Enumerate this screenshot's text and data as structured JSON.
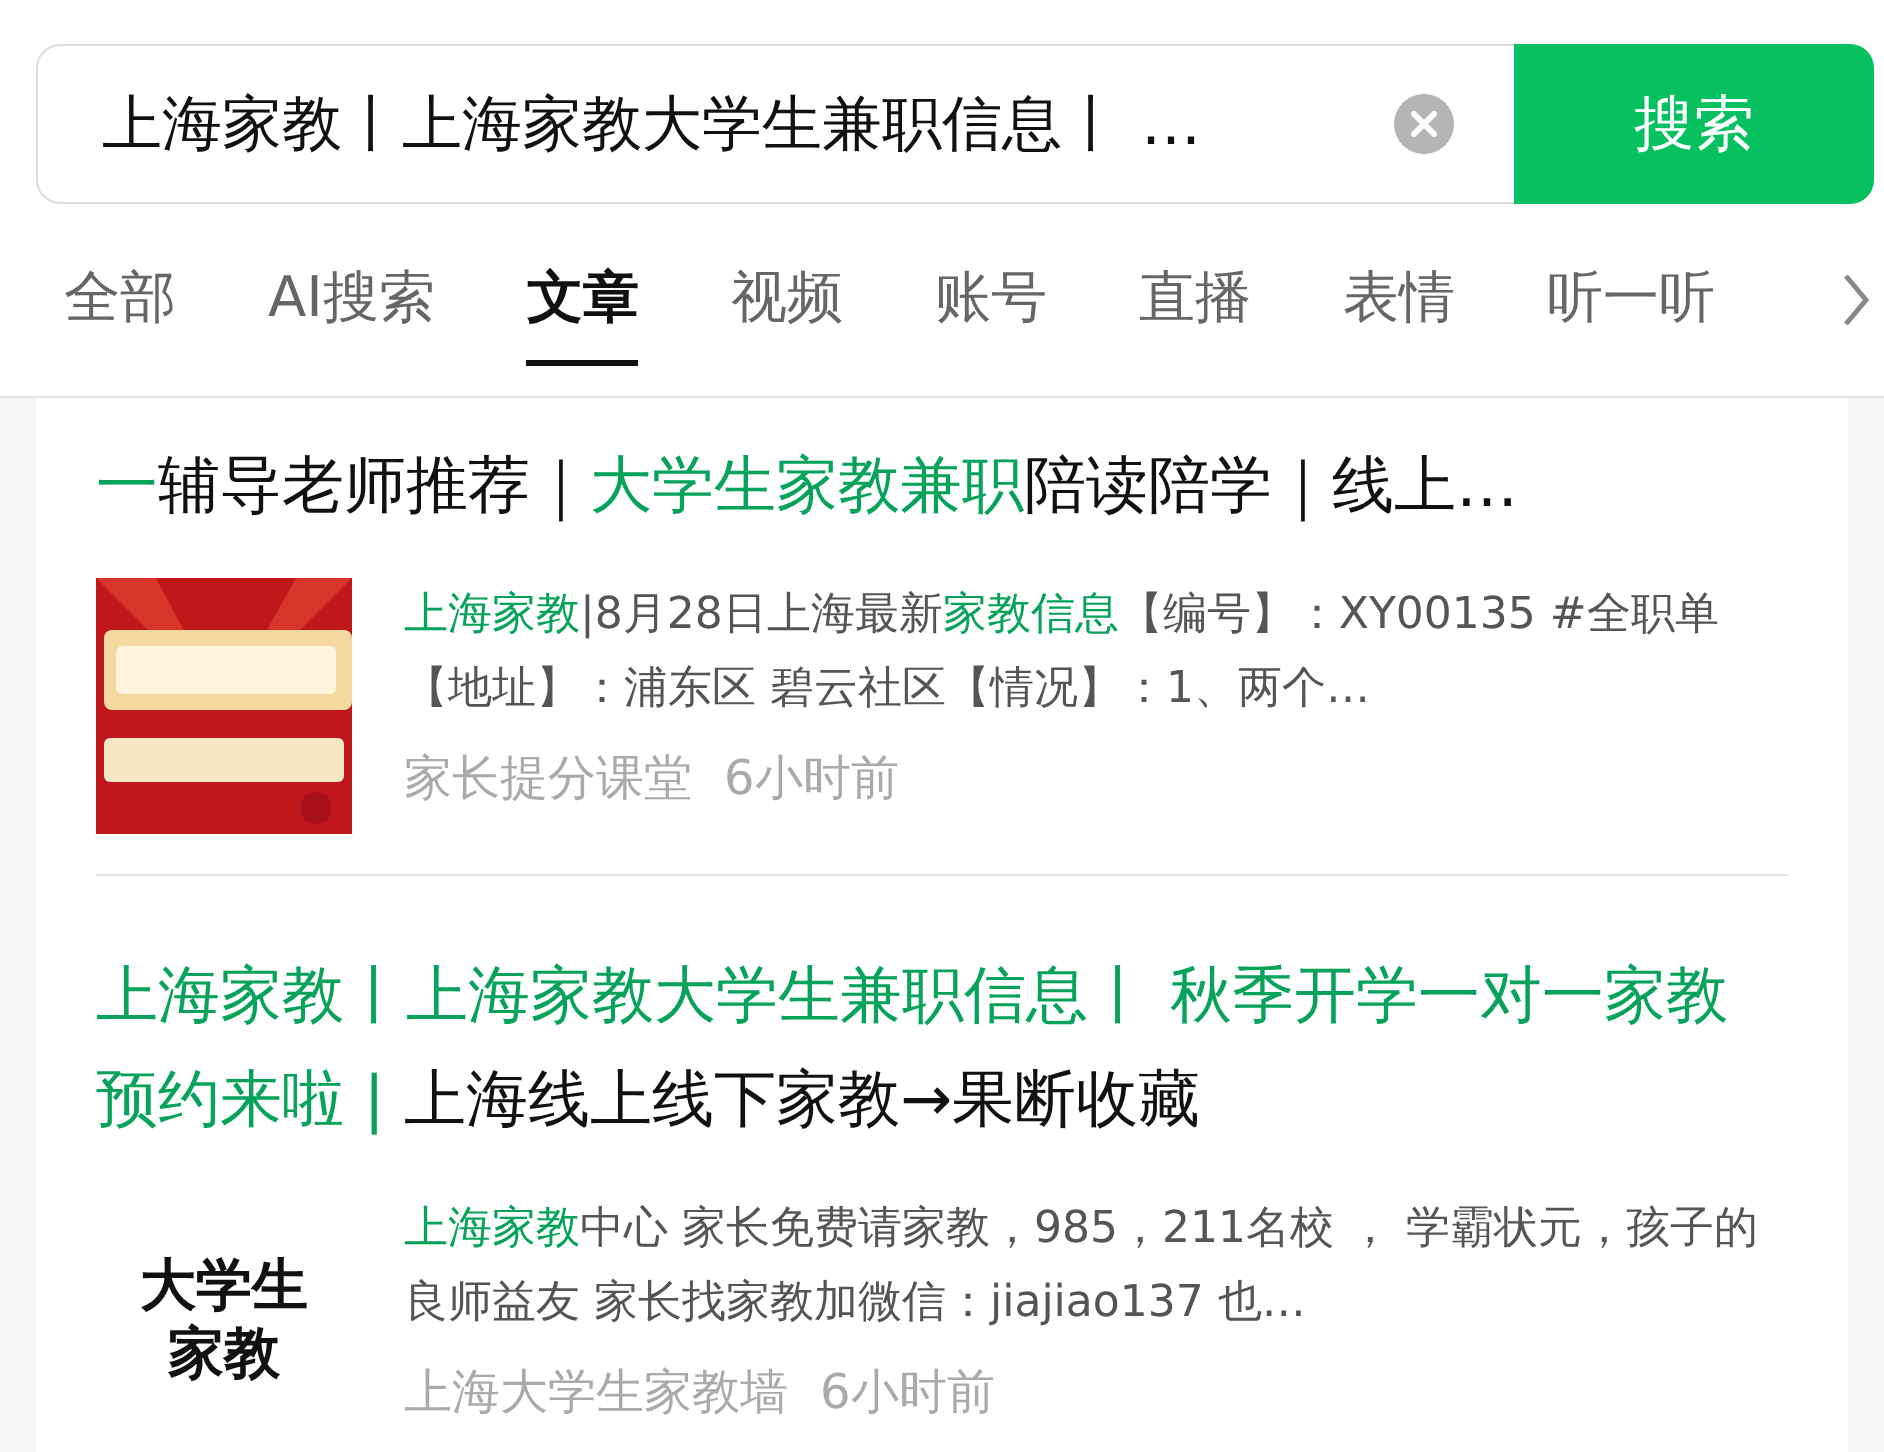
{
  "search": {
    "value": "上海家教丨上海家教大学生兼职信息丨 …",
    "button": "搜索"
  },
  "tabs": [
    {
      "label": "全部",
      "selected": false
    },
    {
      "label": "AI搜索",
      "selected": false
    },
    {
      "label": "文章",
      "selected": true
    },
    {
      "label": "视频",
      "selected": false
    },
    {
      "label": "账号",
      "selected": false
    },
    {
      "label": "直播",
      "selected": false
    },
    {
      "label": "表情",
      "selected": false
    },
    {
      "label": "听一听",
      "selected": false
    }
  ],
  "results": [
    {
      "title": [
        {
          "text": "一",
          "highlight": true
        },
        {
          "text": "辅导老师推荐｜",
          "highlight": false
        },
        {
          "text": "大学生家教兼职",
          "highlight": true
        },
        {
          "text": "陪读陪学｜线上…",
          "highlight": false
        }
      ],
      "desc": [
        {
          "text": "上海家教",
          "highlight": true
        },
        {
          "text": "|8月28日上海最新",
          "highlight": false
        },
        {
          "text": "家教信息",
          "highlight": true
        },
        {
          "text": "【编号】：XY00135 #全职单【地址】：浦东区 碧云社区【情况】：1、两个…",
          "highlight": false
        }
      ],
      "source": "家长提分课堂",
      "time": "6小时前"
    },
    {
      "title": [
        {
          "text": "上海家教丨上海家教大学生兼职信息丨 秋季开学一对一家教预约来啦 | ",
          "highlight": true
        },
        {
          "text": "上海线上线下家教→果断收藏",
          "highlight": false
        }
      ],
      "thumb": {
        "kind": "text",
        "text": "大学生家教"
      },
      "desc": [
        {
          "text": "上海家教",
          "highlight": true
        },
        {
          "text": "中心 家长免费请家教，985，211名校 ， 学霸状元，孩子的良师益友 家长找家教加微信：jiajiao137 也…",
          "highlight": false
        }
      ],
      "source": "上海大学生家教墙",
      "time": "6小时前"
    }
  ]
}
